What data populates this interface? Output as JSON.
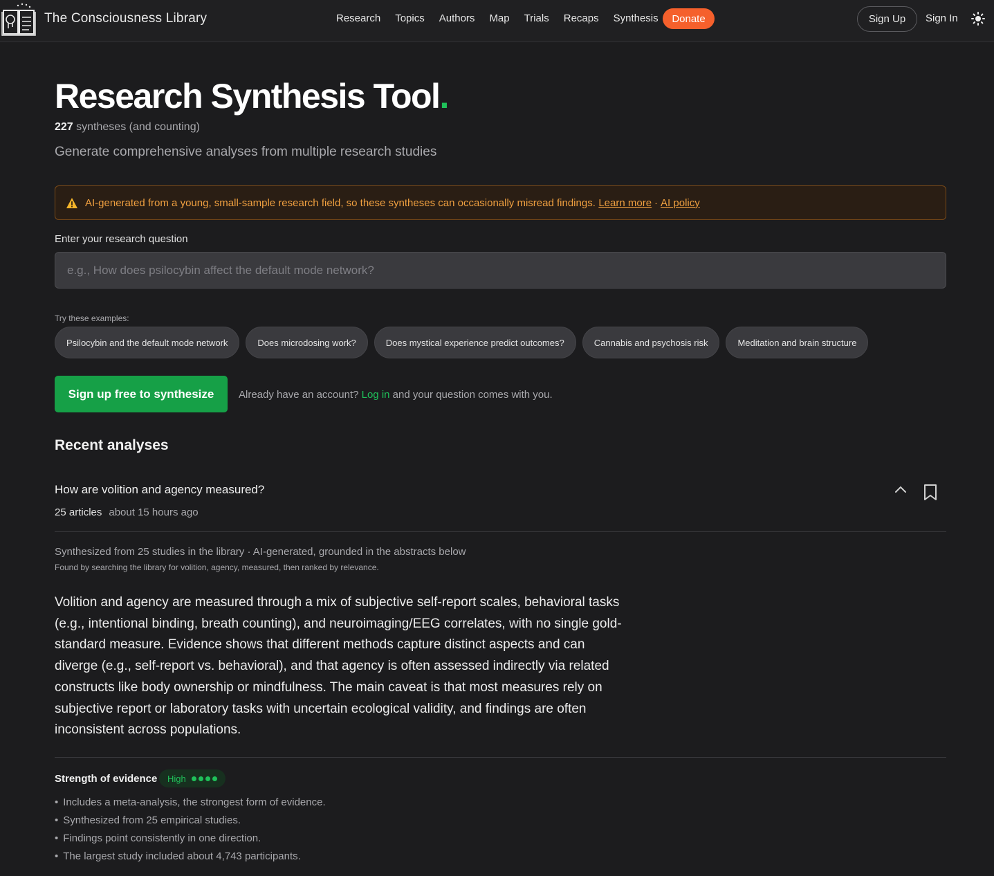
{
  "header": {
    "brand": "The Consciousness Library",
    "nav": [
      "Research",
      "Topics",
      "Authors",
      "Map",
      "Trials",
      "Recaps",
      "Synthesis"
    ],
    "donate": "Donate",
    "sign_up": "Sign Up",
    "sign_in": "Sign In",
    "theme_icon": "sun-icon",
    "logo_icon": "book-head-icon"
  },
  "hero": {
    "title": "Research Synthesis Tool",
    "title_dot": ".",
    "count": "227",
    "count_suffix": " syntheses (and counting)",
    "subtitle": "Generate comprehensive analyses from multiple research studies"
  },
  "warning": {
    "icon": "warning-icon",
    "text": "AI-generated from a young, small-sample research field, so these syntheses can occasionally misread findings.",
    "learn_more": "Learn more",
    "separator": "·",
    "ai_policy": "AI policy"
  },
  "question": {
    "label": "Enter your research question",
    "placeholder": "e.g., How does psilocybin affect the default mode network?",
    "value": ""
  },
  "examples": {
    "label": "Try these examples:",
    "items": [
      "Psilocybin and the default mode network",
      "Does microdosing work?",
      "Does mystical experience predict outcomes?",
      "Cannabis and psychosis risk",
      "Meditation and brain structure"
    ]
  },
  "cta": {
    "button": "Sign up free to synthesize",
    "already_prefix": "Already have an account?",
    "login": "Log in",
    "already_suffix": "and your question comes with you."
  },
  "recent": {
    "heading": "Recent analyses",
    "item": {
      "question": "How are volition and agency measured?",
      "articles": "25 articles",
      "ago": "about 15 hours ago",
      "source": "Synthesized from 25 studies in the library · AI-generated, grounded in the abstracts below",
      "found": "Found by searching the library for volition, agency, measured, then ranked by relevance.",
      "summary": "Volition and agency are measured through a mix of subjective self-report scales, behavioral tasks (e.g., intentional binding, breath counting), and neuroimaging/EEG correlates, with no single gold-standard measure. Evidence shows that different methods capture distinct aspects and can diverge (e.g., self-report vs. behavioral), and that agency is often assessed indirectly via related constructs like body ownership or mindfulness. The main caveat is that most measures rely on subjective report or laboratory tasks with uncertain ecological validity, and findings are often inconsistent across populations.",
      "strength_label": "Strength of evidence",
      "strength_value": "High",
      "strength_level": 4,
      "bullets": [
        "Includes a meta-analysis, the strongest form of evidence.",
        "Synthesized from 25 empirical studies.",
        "Findings point consistently in one direction.",
        "The largest study included about 4,743 participants."
      ]
    }
  },
  "colors": {
    "accent_green": "#1fc15a",
    "donate_orange": "#f5602c",
    "warning_amber": "#f0a040"
  }
}
